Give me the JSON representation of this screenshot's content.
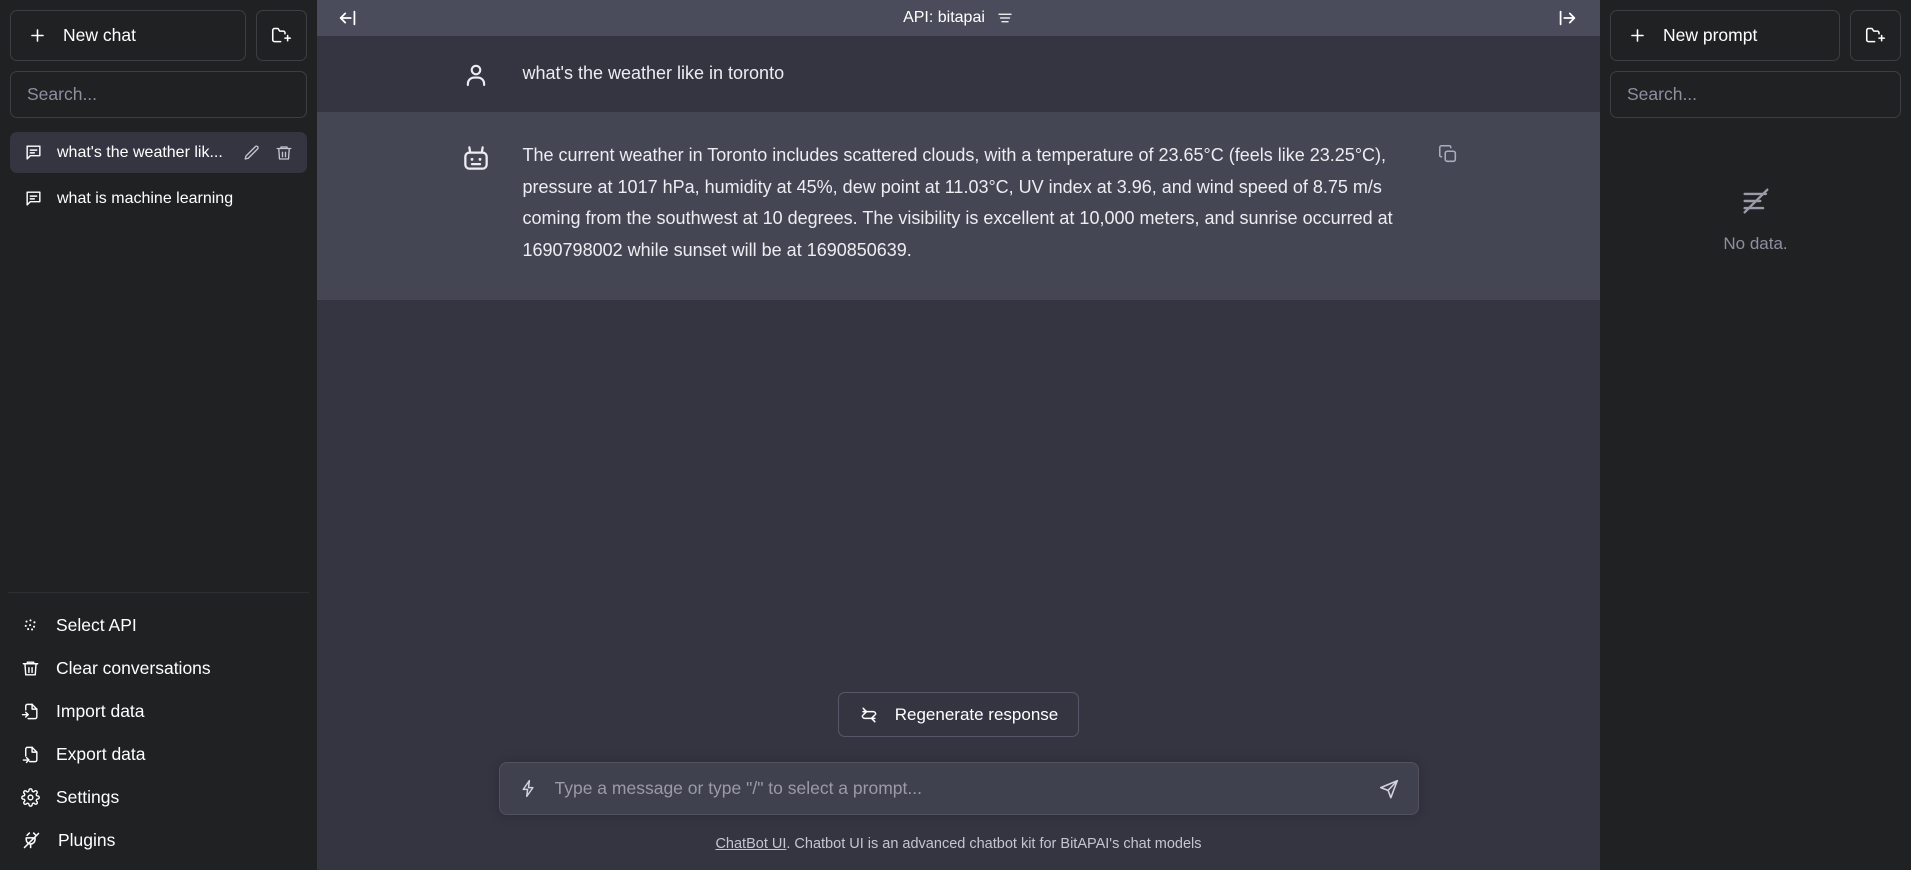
{
  "sidebar_left": {
    "new_chat_label": "New chat",
    "new_chat_icon": "plus-icon",
    "new_folder_icon": "folder-plus-icon",
    "search_placeholder": "Search...",
    "search_value": "",
    "conversations": [
      {
        "label": "what's the weather lik...",
        "icon": "message-icon",
        "active": true,
        "edit_icon": "pencil-icon",
        "delete_icon": "trash-icon"
      },
      {
        "label": "what is machine learning",
        "icon": "message-icon",
        "active": false
      }
    ],
    "menu": [
      {
        "label": "Select API",
        "icon": "dots-scatter-icon"
      },
      {
        "label": "Clear conversations",
        "icon": "trash-icon"
      },
      {
        "label": "Import data",
        "icon": "file-import-icon"
      },
      {
        "label": "Export data",
        "icon": "file-export-icon"
      },
      {
        "label": "Settings",
        "icon": "gear-icon"
      },
      {
        "label": "Plugins",
        "icon": "plug-icon"
      }
    ]
  },
  "topbar": {
    "collapse_left_icon": "arrow-bar-left-icon",
    "collapse_right_icon": "arrow-bar-right-icon",
    "title": "API: bitapai",
    "menu_icon": "hamburger-icon"
  },
  "thread": {
    "messages": [
      {
        "role": "user",
        "avatar_icon": "user-icon",
        "text": "what's the weather like in toronto"
      },
      {
        "role": "assistant",
        "avatar_icon": "robot-icon",
        "copy_icon": "copy-icon",
        "text": "The current weather in Toronto includes scattered clouds, with a temperature of 23.65°C (feels like 23.25°C), pressure at 1017 hPa, humidity at 45%, dew point at 11.03°C, UV index at 3.96, and wind speed of 8.75 m/s coming from the southwest at 10 degrees. The visibility is excellent at 10,000 meters, and sunrise occurred at 1690798002 while sunset will be at 1690850639."
      }
    ]
  },
  "composer": {
    "regenerate_label": "Regenerate response",
    "regenerate_icon": "refresh-icon",
    "prompt_icon": "lightning-icon",
    "placeholder": "Type a message or type \"/\" to select a prompt...",
    "value": "",
    "send_icon": "send-icon"
  },
  "footer": {
    "link_text": "ChatBot UI",
    "text": ". Chatbot UI is an advanced chatbot kit for BitAPAI's chat models"
  },
  "sidebar_right": {
    "new_prompt_label": "New prompt",
    "new_prompt_icon": "plus-icon",
    "new_folder_icon": "folder-plus-icon",
    "search_placeholder": "Search...",
    "search_value": "",
    "empty_icon": "no-data-icon",
    "empty_label": "No data."
  },
  "colors": {
    "sidebar_bg": "#202123",
    "chat_bg": "#343541",
    "assistant_bg": "#444654",
    "topbar_bg": "#4b4c5b",
    "composer_bg": "#40414f",
    "text": "#ffffff",
    "muted": "#8e8ea0"
  }
}
